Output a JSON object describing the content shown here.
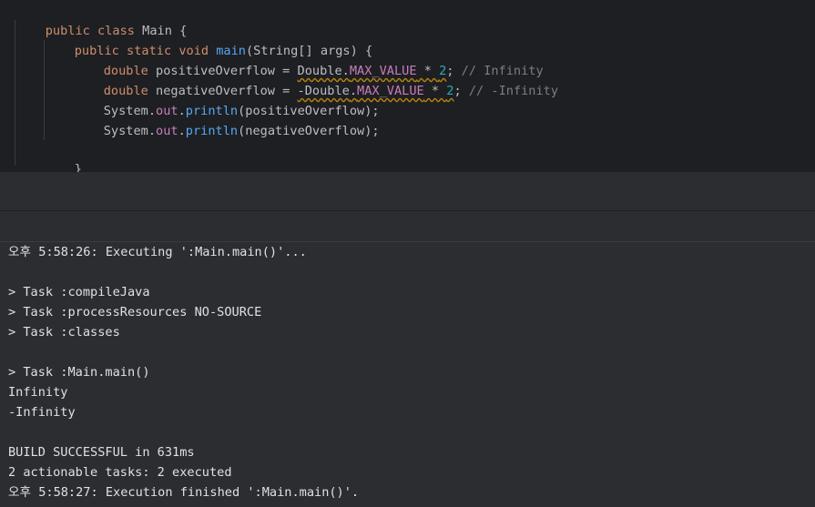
{
  "editor": {
    "lines": [
      {
        "t1": "public class ",
        "t2": "Main",
        "t3": " {"
      },
      {
        "t1": "public static void ",
        "t2": "main",
        "t3": "(String[] args) {"
      },
      {
        "t1": "double ",
        "t2": "positiveOverflow = ",
        "t3": "Double",
        "t4": ".",
        "t5": "MAX_VALUE",
        "t6": " * ",
        "t7": "2",
        "t8": "; ",
        "t9": "// Infinity"
      },
      {
        "t1": "double ",
        "t2": "negativeOverflow = ",
        "t3": "-Double",
        "t4": ".",
        "t5": "MAX_VALUE",
        "t6": " * ",
        "t7": "2",
        "t8": "; ",
        "t9": "// -Infinity"
      },
      {
        "t1": "System",
        "t2": ".",
        "t3": "out",
        "t4": ".",
        "t5": "println",
        "t6": "(positiveOverflow);"
      },
      {
        "t1": "System",
        "t2": ".",
        "t3": "out",
        "t4": ".",
        "t5": "println",
        "t6": "(negativeOverflow);"
      },
      {
        "t1": "}"
      },
      {
        "t1": "}"
      }
    ]
  },
  "console": {
    "lines": [
      "오후 5:58:26: Executing ':Main.main()'...",
      "",
      "> Task :compileJava",
      "> Task :processResources NO-SOURCE",
      "> Task :classes",
      "",
      "> Task :Main.main()",
      "Infinity",
      "-Infinity",
      "",
      "BUILD SUCCESSFUL in 631ms",
      "2 actionable tasks: 2 executed",
      "오후 5:58:27: Execution finished ':Main.main()'."
    ]
  },
  "colors": {
    "editor_bg": "#1e1f22",
    "panel_bg": "#2b2d30",
    "keyword": "#cf8e6d",
    "function": "#56a8f5",
    "static_field": "#c77dbb",
    "number": "#2aacb8",
    "comment": "#7a7e85",
    "text": "#bcbec4"
  }
}
